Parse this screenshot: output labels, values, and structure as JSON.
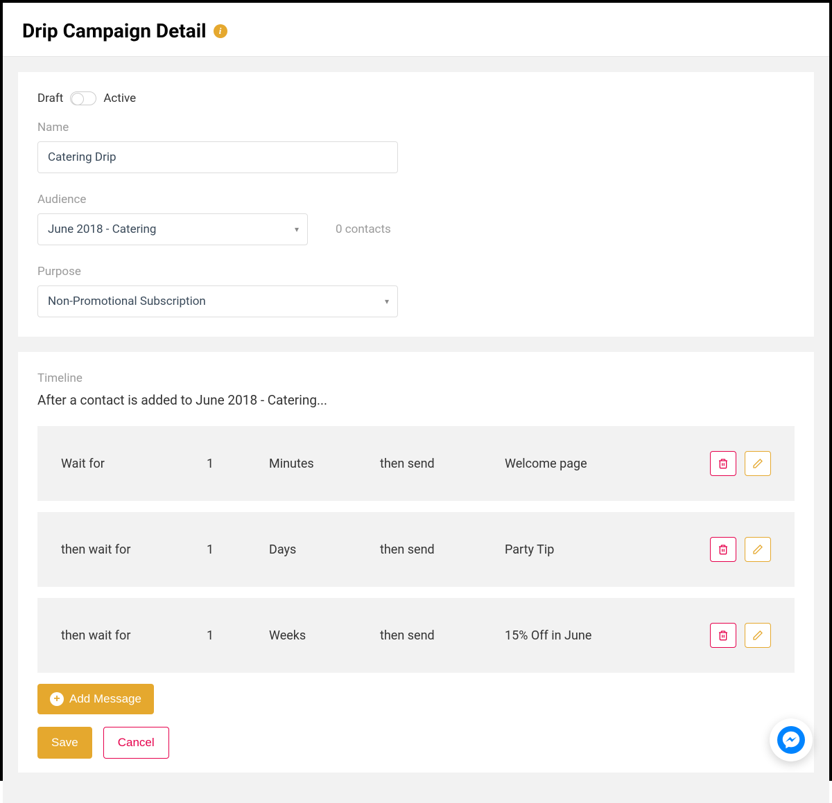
{
  "header": {
    "title": "Drip Campaign Detail"
  },
  "form": {
    "status_draft_label": "Draft",
    "status_active_label": "Active",
    "name_label": "Name",
    "name_value": "Catering Drip",
    "audience_label": "Audience",
    "audience_value": "June 2018 - Catering",
    "contacts_text": "0 contacts",
    "purpose_label": "Purpose",
    "purpose_value": "Non-Promotional Subscription"
  },
  "timeline": {
    "label": "Timeline",
    "note": "After a contact is added to June 2018 - Catering...",
    "rows": [
      {
        "wait": "Wait for",
        "count": "1",
        "unit": "Minutes",
        "then": "then send",
        "page": "Welcome page"
      },
      {
        "wait": "then wait for",
        "count": "1",
        "unit": "Days",
        "then": "then send",
        "page": "Party Tip"
      },
      {
        "wait": "then wait for",
        "count": "1",
        "unit": "Weeks",
        "then": "then send",
        "page": "15% Off in June"
      }
    ],
    "add_label": "Add Message"
  },
  "footer": {
    "save_label": "Save",
    "cancel_label": "Cancel"
  }
}
